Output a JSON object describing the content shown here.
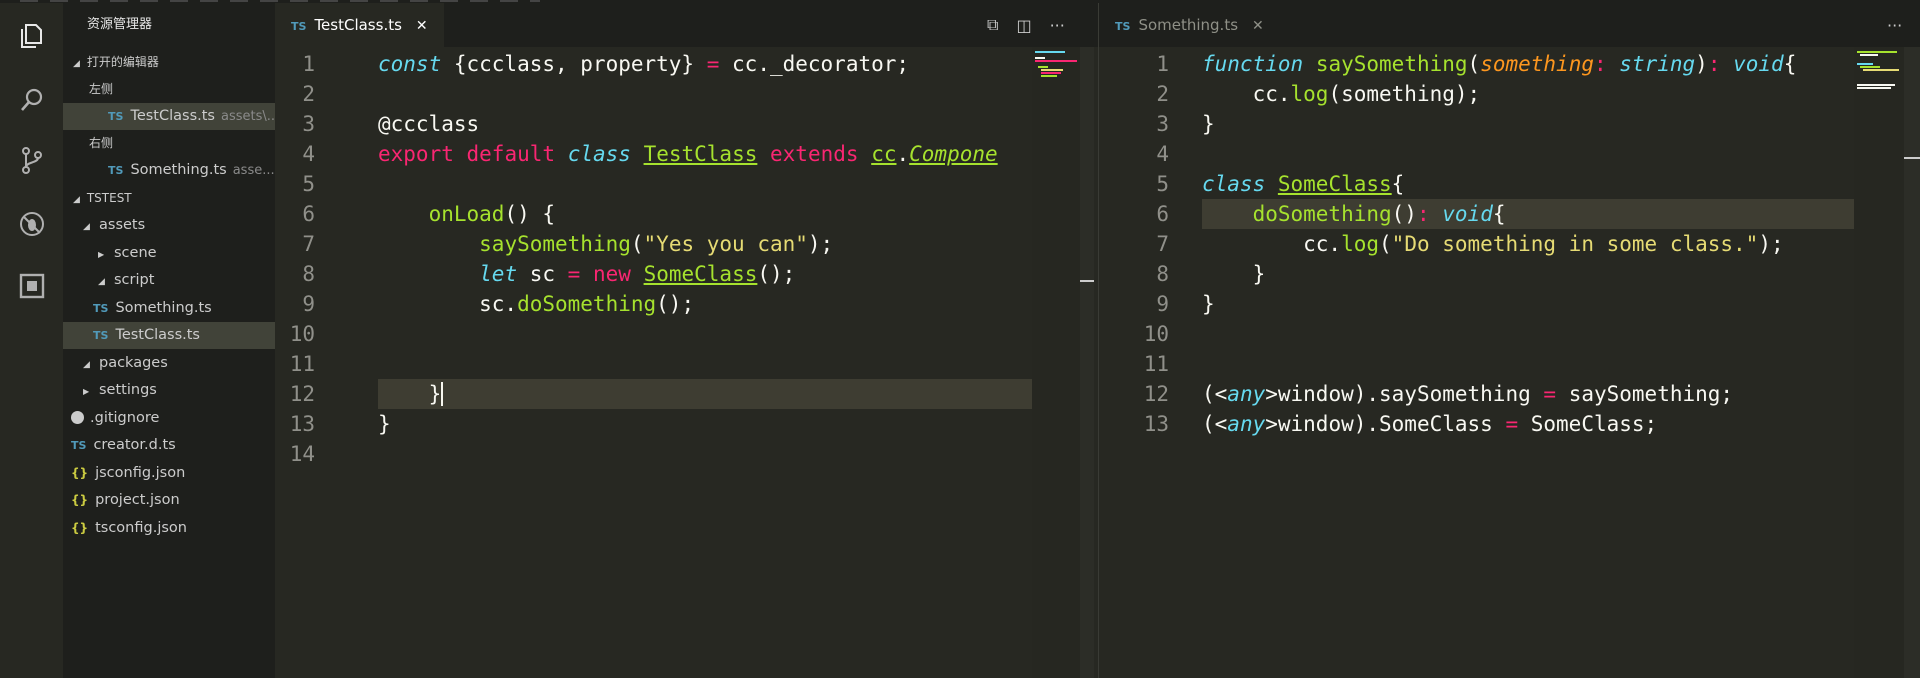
{
  "activity_bar": {
    "icons": [
      "explorer-icon",
      "search-icon",
      "source-control-icon",
      "debug-icon",
      "extensions-icon"
    ]
  },
  "sidebar": {
    "title": "资源管理器",
    "open_editors": {
      "label": "打开的编辑器",
      "groups": [
        {
          "label": "左侧",
          "files": [
            {
              "badge": "TS",
              "name": "TestClass.ts",
              "path": "assets\\..."
            }
          ]
        },
        {
          "label": "右侧",
          "files": [
            {
              "badge": "TS",
              "name": "Something.ts",
              "path": "asse..."
            }
          ]
        }
      ]
    },
    "project": {
      "label": "TSTEST",
      "items": [
        {
          "name": "assets",
          "kind": "folder-open"
        },
        {
          "name": "scene",
          "kind": "folder-closed"
        },
        {
          "name": "script",
          "kind": "folder-open"
        },
        {
          "name": "Something.ts",
          "kind": "ts"
        },
        {
          "name": "TestClass.ts",
          "kind": "ts"
        },
        {
          "name": "packages",
          "kind": "folder-open"
        },
        {
          "name": "settings",
          "kind": "folder-closed"
        },
        {
          "name": ".gitignore",
          "kind": "git"
        },
        {
          "name": "creator.d.ts",
          "kind": "ts"
        },
        {
          "name": "jsconfig.json",
          "kind": "json"
        },
        {
          "name": "project.json",
          "kind": "json"
        },
        {
          "name": "tsconfig.json",
          "kind": "json"
        }
      ]
    }
  },
  "left_editor": {
    "tab": {
      "badge": "TS",
      "label": "TestClass.ts",
      "close": "✕"
    },
    "actions": {
      "open_changes": "⧉",
      "split": "◫",
      "more": "···"
    },
    "line_numbers": [
      "1",
      "2",
      "3",
      "4",
      "5",
      "6",
      "7",
      "8",
      "9",
      "10",
      "11",
      "12",
      "13",
      "14"
    ],
    "lines": [
      [
        [
          "st",
          "const"
        ],
        [
          "wht",
          " {ccclass, property} "
        ],
        [
          "kw",
          "="
        ],
        [
          "wht",
          " cc._decorator;"
        ]
      ],
      [],
      [
        [
          "wht",
          "@ccclass"
        ]
      ],
      [
        [
          "kw",
          "export"
        ],
        [
          "wht",
          " "
        ],
        [
          "kw",
          "default"
        ],
        [
          "wht",
          " "
        ],
        [
          "st",
          "class"
        ],
        [
          "wht",
          " "
        ],
        [
          "cls",
          "TestClass"
        ],
        [
          "wht",
          " "
        ],
        [
          "kw",
          "extends"
        ],
        [
          "wht",
          " "
        ],
        [
          "cls",
          "cc"
        ],
        [
          "wht",
          "."
        ],
        [
          "cls-i",
          "Compone"
        ]
      ],
      [],
      [
        [
          "wht",
          "    "
        ],
        [
          "fn",
          "onLoad"
        ],
        [
          "wht",
          "() {"
        ]
      ],
      [
        [
          "wht",
          "        "
        ],
        [
          "fn",
          "saySomething"
        ],
        [
          "wht",
          "("
        ],
        [
          "str",
          "\"Yes you can\""
        ],
        [
          "wht",
          ");"
        ]
      ],
      [
        [
          "wht",
          "        "
        ],
        [
          "st",
          "let"
        ],
        [
          "wht",
          " sc "
        ],
        [
          "kw",
          "="
        ],
        [
          "wht",
          " "
        ],
        [
          "kw",
          "new"
        ],
        [
          "wht",
          " "
        ],
        [
          "cls",
          "SomeClass"
        ],
        [
          "wht",
          "();"
        ]
      ],
      [
        [
          "wht",
          "        sc."
        ],
        [
          "fn",
          "doSomething"
        ],
        [
          "wht",
          "();"
        ]
      ],
      [],
      [],
      [
        [
          "wht",
          "    }"
        ]
      ],
      [
        [
          "wht",
          "}"
        ]
      ],
      []
    ]
  },
  "right_editor": {
    "tab": {
      "badge": "TS",
      "label": "Something.ts",
      "close": "✕"
    },
    "actions": {
      "more": "···"
    },
    "line_numbers": [
      "1",
      "2",
      "3",
      "4",
      "5",
      "6",
      "7",
      "8",
      "9",
      "10",
      "11",
      "12",
      "13"
    ],
    "lines": [
      [
        [
          "st",
          "function"
        ],
        [
          "wht",
          " "
        ],
        [
          "fn",
          "saySomething"
        ],
        [
          "wht",
          "("
        ],
        [
          "par",
          "something"
        ],
        [
          "kw",
          ":"
        ],
        [
          "wht",
          " "
        ],
        [
          "st",
          "string"
        ],
        [
          "wht",
          ")"
        ],
        [
          "kw",
          ":"
        ],
        [
          "wht",
          " "
        ],
        [
          "st",
          "void"
        ],
        [
          "wht",
          "{"
        ]
      ],
      [
        [
          "wht",
          "    cc."
        ],
        [
          "fn",
          "log"
        ],
        [
          "wht",
          "(something);"
        ]
      ],
      [
        [
          "wht",
          "}"
        ]
      ],
      [],
      [
        [
          "st",
          "class"
        ],
        [
          "wht",
          " "
        ],
        [
          "cls",
          "SomeClass"
        ],
        [
          "wht",
          "{"
        ]
      ],
      [
        [
          "wht",
          "    "
        ],
        [
          "fn",
          "doSomething"
        ],
        [
          "wht",
          "()"
        ],
        [
          "kw",
          ":"
        ],
        [
          "wht",
          " "
        ],
        [
          "st",
          "void"
        ],
        [
          "wht",
          "{"
        ]
      ],
      [
        [
          "wht",
          "        cc."
        ],
        [
          "fn",
          "log"
        ],
        [
          "wht",
          "("
        ],
        [
          "str",
          "\"Do something in some class.\""
        ],
        [
          "wht",
          ");"
        ]
      ],
      [
        [
          "wht",
          "    }"
        ]
      ],
      [
        [
          "wht",
          "}"
        ]
      ],
      [],
      [],
      [
        [
          "wht",
          "(<"
        ],
        [
          "st",
          "any"
        ],
        [
          "wht",
          ">window).saySomething "
        ],
        [
          "kw",
          "="
        ],
        [
          "wht",
          " saySomething;"
        ]
      ],
      [
        [
          "wht",
          "(<"
        ],
        [
          "st",
          "any"
        ],
        [
          "wht",
          ">window).SomeClass "
        ],
        [
          "kw",
          "="
        ],
        [
          "wht",
          " SomeClass;"
        ]
      ]
    ]
  }
}
